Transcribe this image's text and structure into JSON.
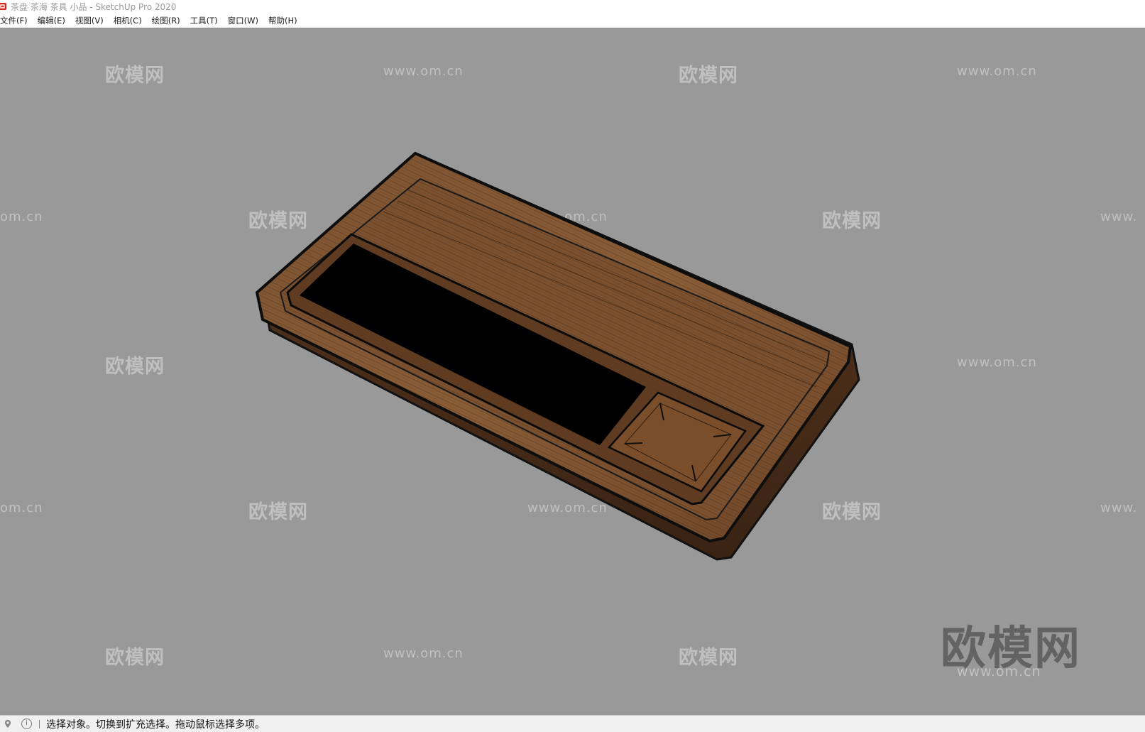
{
  "window": {
    "title": "茶盘 茶海 茶具 小品 - SketchUp Pro 2020",
    "logo_icon": "sketchup-logo-icon",
    "logo_color": "#d7261b"
  },
  "menubar": {
    "items": [
      {
        "label": "文件(F)"
      },
      {
        "label": "编辑(E)"
      },
      {
        "label": "视图(V)"
      },
      {
        "label": "相机(C)"
      },
      {
        "label": "绘图(R)"
      },
      {
        "label": "工具(T)"
      },
      {
        "label": "窗口(W)"
      },
      {
        "label": "帮助(H)"
      }
    ]
  },
  "viewport": {
    "background_color": "#999999",
    "model_wood_color": "#7a4e2b",
    "cutout_color": "#000000"
  },
  "watermarks": {
    "brand": "欧模网",
    "url": "www.om.cn",
    "url_partial_left": "om.cn",
    "url_partial_right": "www."
  },
  "statusbar": {
    "geo_icon": "geo-location-icon",
    "info_icon": "info-icon",
    "message": "选择对象。切换到扩充选择。拖动鼠标选择多项。"
  }
}
